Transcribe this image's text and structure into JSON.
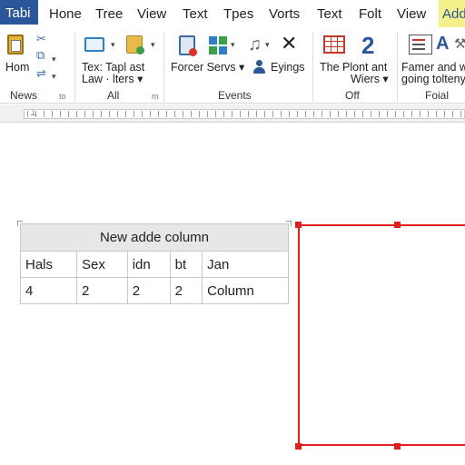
{
  "tabs": [
    "Tabi",
    "Hone",
    "Tree",
    "View",
    "Text",
    "Tpes",
    "Vorts",
    "Text",
    "Folt",
    "View",
    "Adde"
  ],
  "ribbon": {
    "clipboard": {
      "label": "Hom",
      "group": "News",
      "launcher": "to"
    },
    "all": {
      "line1": "Tex: Tapl ast",
      "line2": "Law ·  lters ▾",
      "group": "All",
      "launcher": "m"
    },
    "events": {
      "forcer": "Forcer Servs ▾",
      "eyings": "Eyings",
      "group": "Events"
    },
    "off": {
      "line1": "The Plont ant",
      "line2": "Wiers ▾",
      "group": "Off"
    },
    "foial": {
      "line1": "Famer and w",
      "line2": "going tolteny",
      "group": "Foial"
    }
  },
  "table": {
    "title": "New adde column",
    "headers": [
      "Hals",
      "Sex",
      "idn",
      "bt",
      "Jan"
    ],
    "row": [
      "4",
      "2",
      "2",
      "2",
      "Column"
    ]
  },
  "icons": {
    "accent": "#2b579a",
    "selection": "#e02020",
    "highlight": "#f4f08c"
  }
}
